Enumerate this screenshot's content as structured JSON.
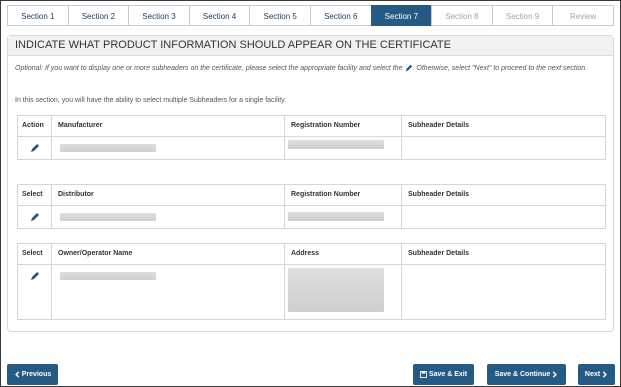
{
  "tabs": [
    {
      "label": "Section 1",
      "state": "normal"
    },
    {
      "label": "Section 2",
      "state": "normal"
    },
    {
      "label": "Section 3",
      "state": "normal"
    },
    {
      "label": "Section 4",
      "state": "normal"
    },
    {
      "label": "Section 5",
      "state": "normal"
    },
    {
      "label": "Section 6",
      "state": "normal"
    },
    {
      "label": "Section 7",
      "state": "active"
    },
    {
      "label": "Section 8",
      "state": "disabled"
    },
    {
      "label": "Section 9",
      "state": "disabled"
    },
    {
      "label": "Review",
      "state": "disabled"
    }
  ],
  "panel": {
    "title": "INDICATE WHAT PRODUCT INFORMATION SHOULD APPEAR ON THE CERTIFICATE",
    "optional_text_before": "Optional: If you want to display one or more subheaders on the certificate, please select the appropriate facility and select the",
    "optional_text_after": ". Otherwise, select \"Next\" to proceed to the next section.",
    "info_text": "In this section, you will have the ability to select multiple Subheaders for a single facility."
  },
  "tables": {
    "manufacturer": {
      "headers": [
        "Action",
        "Manufacturer",
        "Registration Number",
        "Subheader Details"
      ]
    },
    "distributor": {
      "headers": [
        "Select",
        "Distributor",
        "Registration Number",
        "Subheader Details"
      ]
    },
    "owner": {
      "headers": [
        "Select",
        "Owner/Operator Name",
        "Address",
        "Subheader Details"
      ]
    }
  },
  "footer": {
    "previous": "Previous",
    "save_exit": "Save & Exit",
    "save_continue": "Save & Continue",
    "next": "Next"
  },
  "colors": {
    "accent": "#255a85",
    "tab_border": "#c6ccd3",
    "panel_header": "#f1f1f1"
  },
  "icons": {
    "edit": "pencil-icon",
    "save": "floppy-disk-icon",
    "previous": "chevron-left-icon",
    "next": "chevron-right-icon"
  }
}
